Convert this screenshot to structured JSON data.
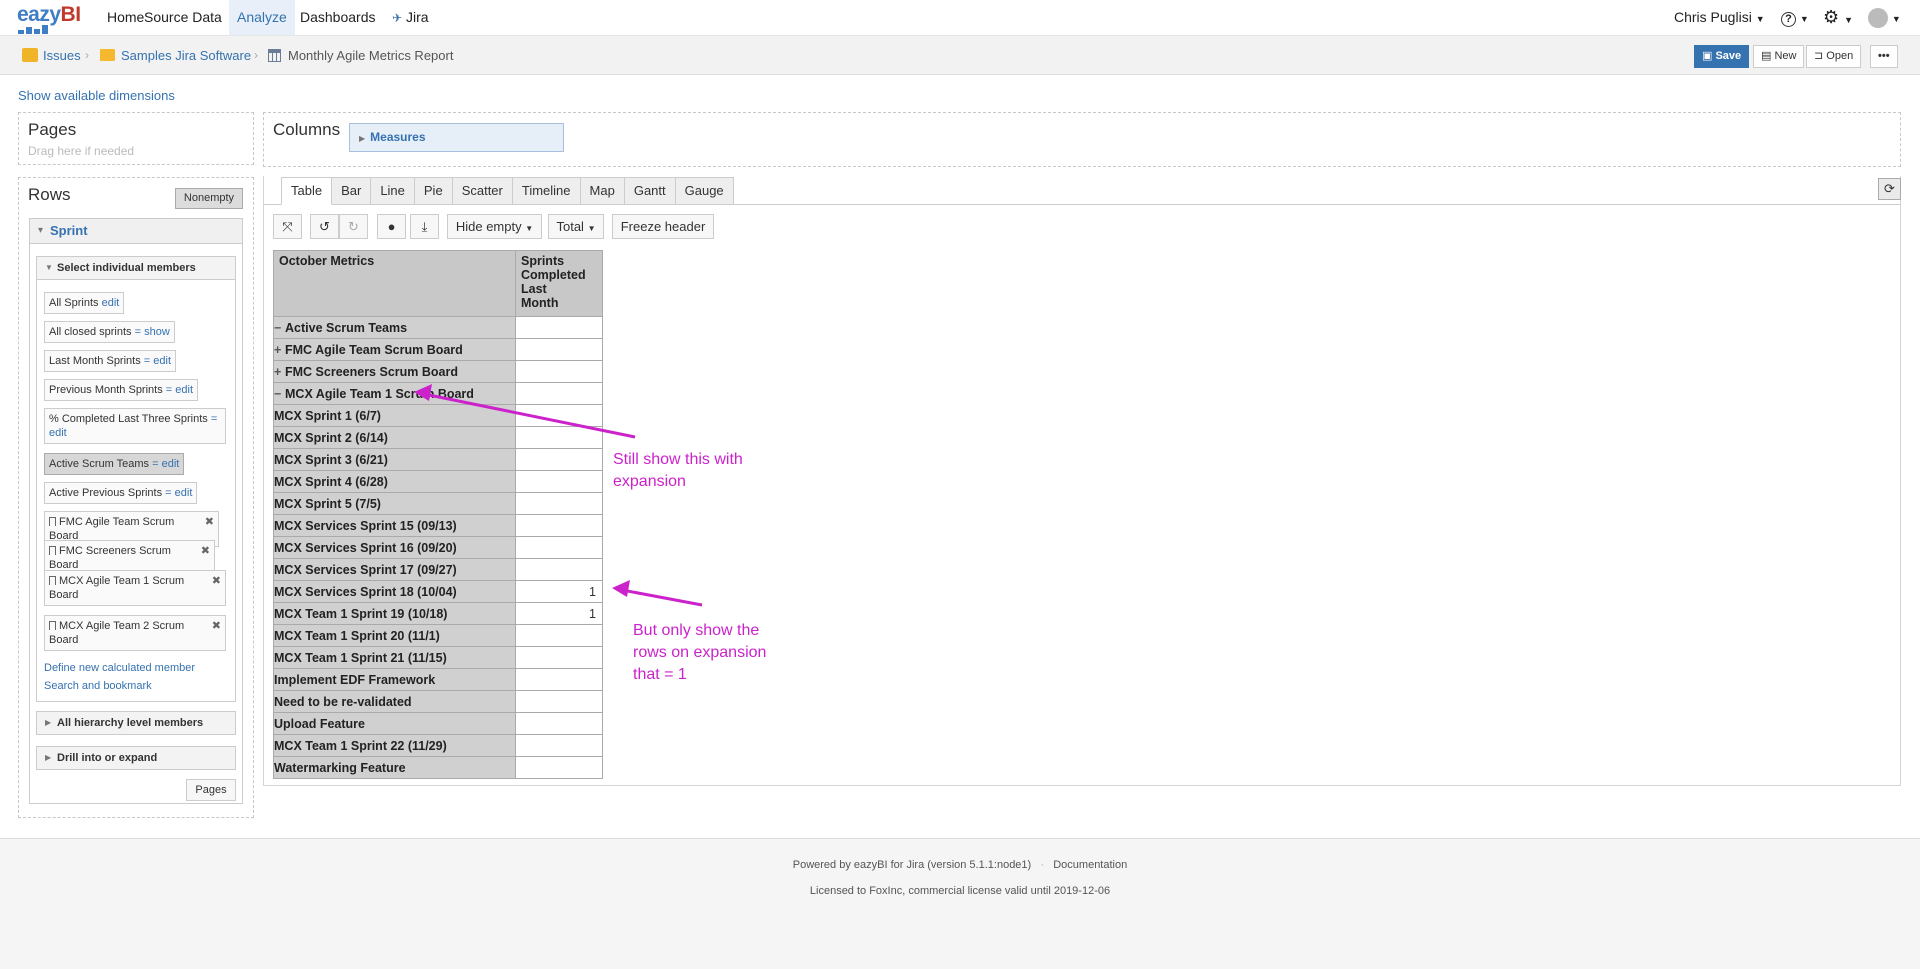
{
  "nav": {
    "logo": {
      "left": "eazy",
      "right": "BI"
    },
    "items": [
      {
        "label": "Home"
      },
      {
        "label": "Source Data"
      },
      {
        "label": "Analyze"
      },
      {
        "label": "Dashboards"
      },
      {
        "label": "Jira"
      }
    ],
    "user": "Chris Puglisi",
    "help": "?",
    "gear": "⚙"
  },
  "breadcrumb": {
    "items": [
      "Issues",
      "Samples Jira Software",
      "Monthly Agile Metrics Report"
    ]
  },
  "toolbar": {
    "save": "Save",
    "new": "New",
    "open": "Open",
    "more": "•••"
  },
  "show_dimensions": "Show available dimensions",
  "pages": {
    "title": "Pages",
    "hint": "Drag here if needed"
  },
  "columns": {
    "title": "Columns",
    "measures": "Measures"
  },
  "rows": {
    "title": "Rows",
    "nonempty": "Nonempty",
    "dimension": "Sprint",
    "select_members": "Select individual members",
    "members": [
      {
        "label": "All Sprints",
        "action": "edit"
      },
      {
        "label": "All closed sprints",
        "eq": "=",
        "action": "show"
      },
      {
        "label": "Last Month Sprints",
        "eq": "=",
        "action": "edit"
      },
      {
        "label": "Previous Month Sprints",
        "eq": "=",
        "action": "edit"
      },
      {
        "label": "% Completed Last Three Sprints",
        "eq": "=",
        "action": "edit"
      },
      {
        "label": "Active Scrum Teams",
        "eq": "=",
        "action": "edit"
      },
      {
        "label": "Active Previous Sprints",
        "eq": "=",
        "action": "edit"
      },
      {
        "label": "FMC Agile Team Scrum Board",
        "remove": "✖"
      },
      {
        "label": "FMC Screeners Scrum Board",
        "remove": "✖"
      },
      {
        "label": "MCX Agile Team 1 Scrum Board",
        "remove": "✖"
      },
      {
        "label": "MCX Agile Team 2 Scrum Board",
        "remove": "✖"
      }
    ],
    "define_calc": "Define new calculated member",
    "search_bookmark": "Search and bookmark",
    "all_hierarchy": "All hierarchy level members",
    "drill": "Drill into or expand",
    "pages_btn": "Pages"
  },
  "tabs": [
    "Table",
    "Bar",
    "Line",
    "Pie",
    "Scatter",
    "Timeline",
    "Map",
    "Gantt",
    "Gauge"
  ],
  "table_tools": {
    "hide_empty": "Hide empty",
    "total": "Total",
    "freeze": "Freeze header"
  },
  "pivot": {
    "corner": "October Metrics",
    "column_header": [
      "Sprints",
      "Completed",
      "Last",
      "Month"
    ],
    "rows": [
      {
        "label": "Active Scrum Teams",
        "toggle": "−",
        "value": ""
      },
      {
        "label": "FMC Agile Team Scrum Board",
        "toggle": "+",
        "value": ""
      },
      {
        "label": "FMC Screeners Scrum Board",
        "toggle": "+",
        "value": ""
      },
      {
        "label": "MCX Agile Team 1 Scrum Board",
        "toggle": "−",
        "value": ""
      },
      {
        "label": "MCX Sprint 1 (6/7)",
        "value": ""
      },
      {
        "label": "MCX Sprint 2 (6/14)",
        "value": ""
      },
      {
        "label": "MCX Sprint 3 (6/21)",
        "value": ""
      },
      {
        "label": "MCX Sprint 4 (6/28)",
        "value": ""
      },
      {
        "label": "MCX Sprint 5 (7/5)",
        "value": ""
      },
      {
        "label": "MCX Services Sprint 15 (09/13)",
        "value": ""
      },
      {
        "label": "MCX Services Sprint 16 (09/20)",
        "value": ""
      },
      {
        "label": "MCX Services Sprint 17 (09/27)",
        "value": ""
      },
      {
        "label": "MCX Services Sprint 18 (10/04)",
        "value": "1"
      },
      {
        "label": "MCX Team 1 Sprint 19 (10/18)",
        "value": "1"
      },
      {
        "label": "MCX Team 1 Sprint 20 (11/1)",
        "value": ""
      },
      {
        "label": "MCX Team 1 Sprint 21 (11/15)",
        "value": ""
      },
      {
        "label": "Implement EDF Framework",
        "value": ""
      },
      {
        "label": "Need to be re-validated",
        "value": ""
      },
      {
        "label": "Upload Feature",
        "value": ""
      },
      {
        "label": "MCX Team 1 Sprint 22 (11/29)",
        "value": ""
      },
      {
        "label": "Watermarking Feature",
        "value": ""
      }
    ]
  },
  "annotations": {
    "note1": [
      "Still show this with",
      "expansion"
    ],
    "note2": [
      "But only show the",
      "rows on expansion",
      "that = 1"
    ],
    "color": "#cc22cc"
  },
  "footer": {
    "powered": "Powered by eazyBI for Jira (version 5.1.1:node1)",
    "dot": "·",
    "documentation": "Documentation",
    "license": "Licensed to FoxInc, commercial license valid until 2019-12-06"
  }
}
